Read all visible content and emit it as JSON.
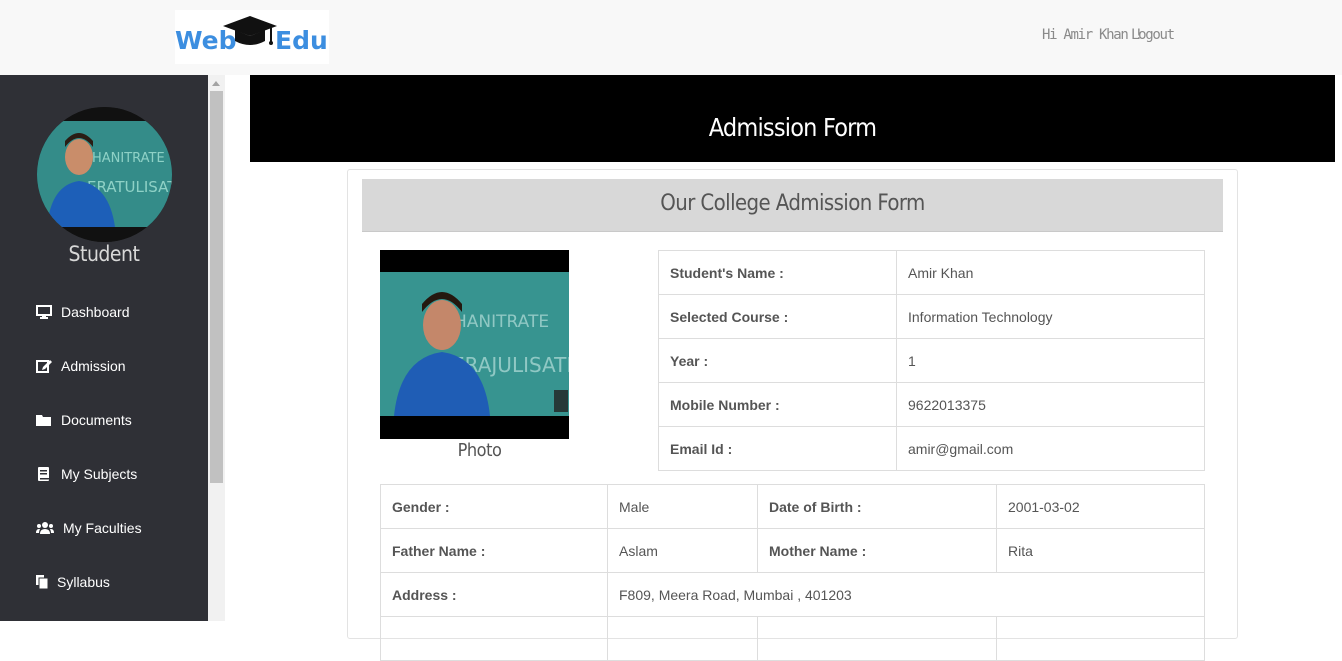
{
  "header": {
    "logo_left": "Web",
    "logo_right": "Edu",
    "greeting": "Hi Amir Khan !",
    "logout": "Logout"
  },
  "sidebar": {
    "role": "Student",
    "items": [
      {
        "label": "Dashboard",
        "icon": "desktop-icon"
      },
      {
        "label": "Admission",
        "icon": "edit-icon"
      },
      {
        "label": "Documents",
        "icon": "folder-icon"
      },
      {
        "label": "My Subjects",
        "icon": "book-icon"
      },
      {
        "label": "My Faculties",
        "icon": "users-icon"
      },
      {
        "label": "Syllabus",
        "icon": "files-icon"
      }
    ]
  },
  "main": {
    "banner_title": "Admission Form",
    "panel_title": "Our College Admission Form",
    "photo_caption": "Photo",
    "student_info": [
      {
        "label": "Student's Name :",
        "value": "Amir Khan"
      },
      {
        "label": "Selected Course :",
        "value": "Information Technology"
      },
      {
        "label": "Year :",
        "value": "1"
      },
      {
        "label": "Mobile Number :",
        "value": "9622013375"
      },
      {
        "label": "Email Id :",
        "value": "amir@gmail.com"
      }
    ],
    "details": {
      "gender_label": "Gender :",
      "gender": "Male",
      "dob_label": "Date of Birth :",
      "dob": "2001-03-02",
      "father_label": "Father Name :",
      "father": "Aslam",
      "mother_label": "Mother Name :",
      "mother": "Rita",
      "address_label": "Address :",
      "address": "F809, Meera Road, Mumbai , 401203"
    }
  },
  "colors": {
    "sidebar_bg": "#2f3036",
    "banner_bg": "#000000",
    "logo_blue": "#3c8ee0",
    "panel_head_bg": "#d8d8d8"
  }
}
